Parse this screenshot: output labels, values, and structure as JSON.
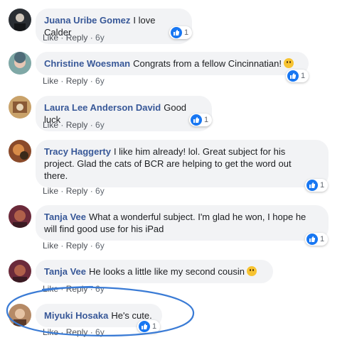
{
  "actions": {
    "like": "Like",
    "reply": "Reply",
    "sep": " · "
  },
  "comments": [
    {
      "author": "Juana Uribe Gomez",
      "text": "I love Calder",
      "time": "6y",
      "reactions": "1",
      "avatar_color": "#2a2e33"
    },
    {
      "author": "Christine Woesman",
      "text": "Congrats from a fellow Cincinnatian!",
      "time": "6y",
      "reactions": "1",
      "avatar_color": "#7fa8a6",
      "emoji": "smile-emoji"
    },
    {
      "author": "Laura Lee Anderson David",
      "text": "Good luck",
      "time": "6y",
      "reactions": "1",
      "avatar_color": "#c9a26a"
    },
    {
      "author": "Tracy Haggerty",
      "text_lines": [
        "I like him already! lol. Great subject for his",
        "project. Glad the cats of BCR are helping to get the word out",
        "there."
      ],
      "time": "6y",
      "reactions": "1",
      "avatar_color": "#8a4a2a"
    },
    {
      "author": "Tanja Vee",
      "text_lines": [
        "What a wonderful subject. I'm glad he won, I hope he",
        "will find good use for his iPad"
      ],
      "time": "6y",
      "reactions": "1",
      "avatar_color": "#6b2a3a"
    },
    {
      "author": "Tanja Vee",
      "text": "He looks a little like my second cousin",
      "time": "6y",
      "avatar_color": "#6b2a3a",
      "emoji": "smile-emoji"
    },
    {
      "author": "Miyuki Hosaka",
      "text": "He's cute.",
      "time": "6y",
      "reactions": "1",
      "avatar_color": "#b58a66"
    }
  ],
  "colors": {
    "author": "#385898",
    "like_blue": "#1877f2",
    "annotation": "#3a7bd5",
    "bubble": "#f2f3f5"
  }
}
